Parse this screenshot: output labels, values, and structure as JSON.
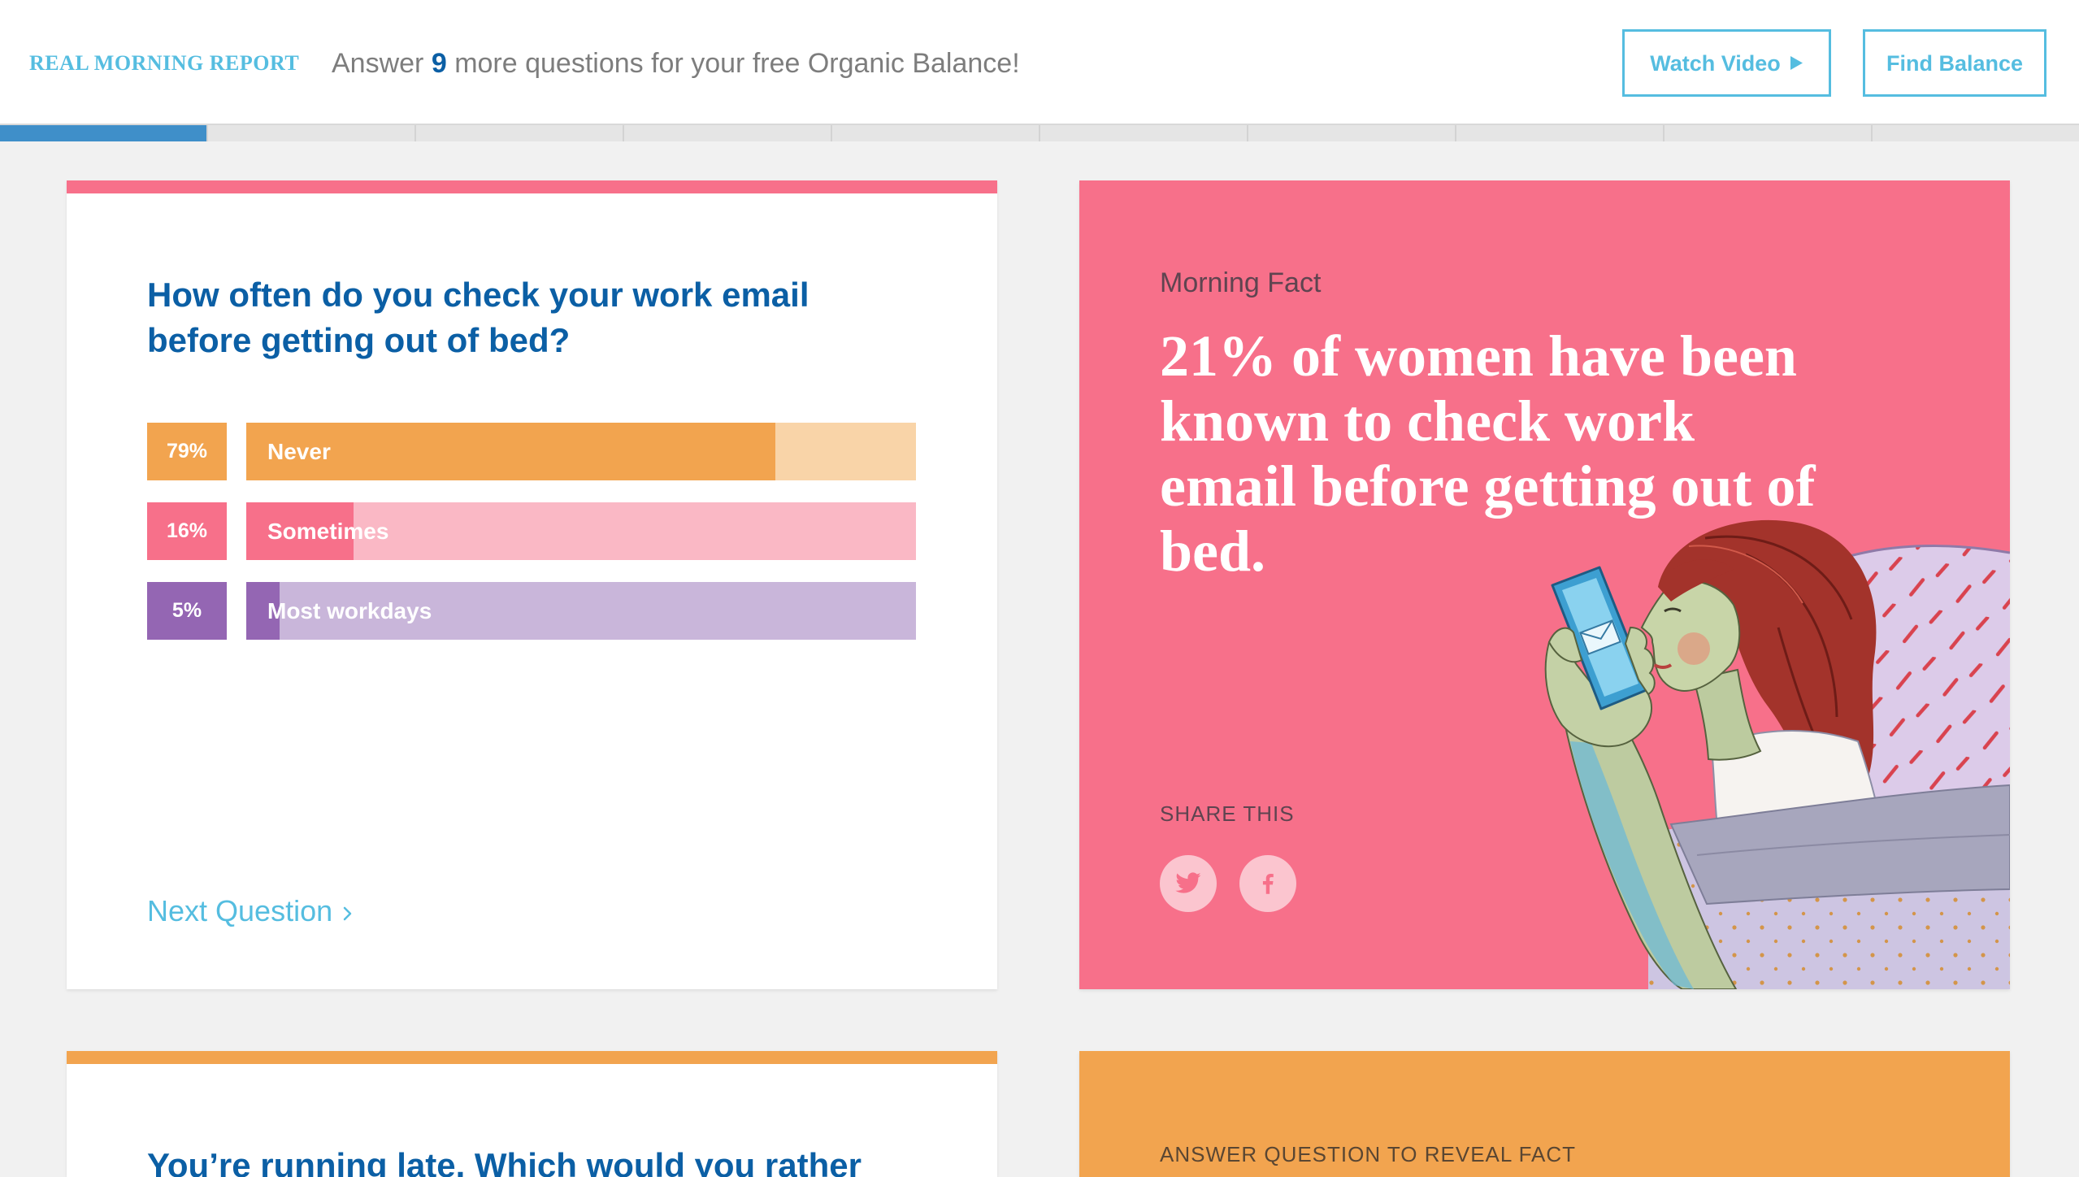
{
  "header": {
    "brand": "REAL MORNING REPORT",
    "prompt_prefix": "Answer",
    "remaining_count": "9",
    "prompt_suffix": "more questions for your free Organic Balance!",
    "watch_video_label": "Watch Video",
    "watch_video_icon": "play-icon",
    "find_balance_label": "Find Balance"
  },
  "progress": {
    "completed_segments": 1,
    "total_segments": 10
  },
  "question_card": {
    "accent_color": "#f7708a",
    "question": "How often do you check your work email before getting out of bed?",
    "answers": [
      {
        "percent_label": "79%",
        "label": "Never",
        "fill": 0.79,
        "color": "#f2a44f",
        "light_color": "#f9d4a8"
      },
      {
        "percent_label": "16%",
        "label": "Sometimes",
        "fill": 0.16,
        "color": "#f7708a",
        "light_color": "#fab8c5"
      },
      {
        "percent_label": "5%",
        "label": "Most workdays",
        "fill": 0.05,
        "color": "#9466b3",
        "light_color": "#c9b6da"
      }
    ],
    "next_label": "Next Question",
    "next_icon": "chevron-right-icon"
  },
  "fact_card": {
    "background_color": "#f7708a",
    "heading": "Morning Fact",
    "fact": "21% of women have been known to check work email before getting out of bed.",
    "share_label": "SHARE THIS",
    "share_icons": [
      "twitter-icon",
      "facebook-icon"
    ]
  },
  "next_question_card": {
    "accent_color": "#f2a44f",
    "question": "You’re running late. Which would you rather"
  },
  "next_fact_card": {
    "background_color": "#f2a44f",
    "prompt": "ANSWER QUESTION TO REVEAL FACT"
  },
  "colors": {
    "brand_blue": "#55bde0",
    "title_blue": "#0b5fa5",
    "progress_fill": "#3f8fc9",
    "progress_track": "#e5e5e5",
    "page_background": "#f1f1f1"
  }
}
